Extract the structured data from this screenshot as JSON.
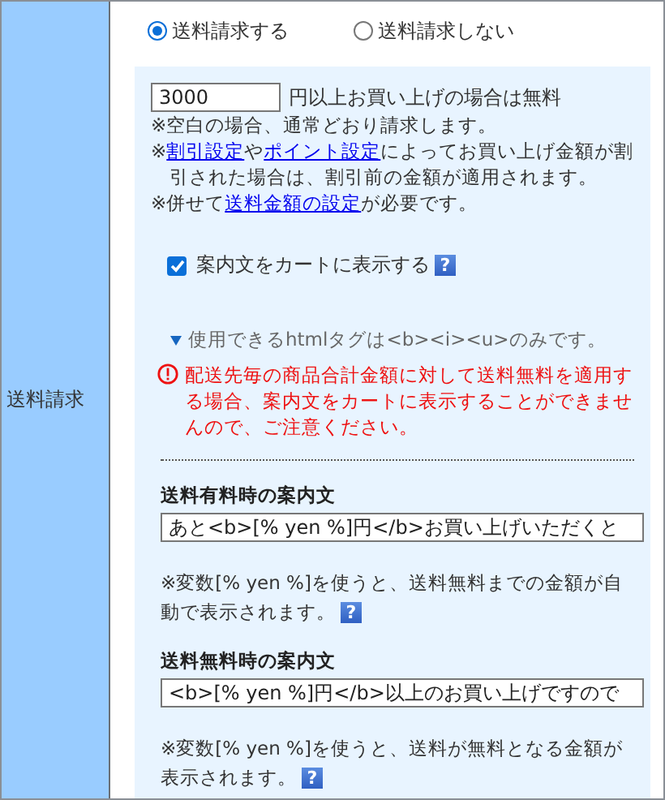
{
  "row_label": "送料請求",
  "radios": [
    {
      "label": "送料請求する",
      "selected": true
    },
    {
      "label": "送料請求しない",
      "selected": false
    }
  ],
  "threshold": {
    "value": "3000",
    "suffix": "円以上お買い上げの場合は無料"
  },
  "notes": [
    {
      "parts": [
        {
          "text": "※空白の場合、通常どおり請求します。",
          "link": false
        }
      ]
    },
    {
      "parts": [
        {
          "text": "※",
          "link": false
        },
        {
          "text": "割引設定",
          "link": true
        },
        {
          "text": "や",
          "link": false
        },
        {
          "text": "ポイント設定",
          "link": true
        },
        {
          "text": "によってお買い上げ金額が割引された場合は、割引前の金額が適用されます。",
          "link": false
        }
      ]
    },
    {
      "parts": [
        {
          "text": "※併せて",
          "link": false
        },
        {
          "text": "送料金額の設定",
          "link": true
        },
        {
          "text": "が必要です。",
          "link": false
        }
      ]
    }
  ],
  "cart_option": {
    "label": "案内文をカートに表示する",
    "checked": true,
    "help": "?"
  },
  "tags_note": "使用できるhtmlタグは<b><i><u>のみです。",
  "warning": "配送先毎の商品合計金額に対して送料無料を適用する場合、案内文をカートに表示することができませんので、ご注意ください。",
  "messages": [
    {
      "title": "送料有料時の案内文",
      "value": "あと<b>[% yen %]円</b>お買い上げいただくと",
      "note": "※変数[% yen %]を使うと、送料無料までの金額が自動で表示されます。",
      "help": "?"
    },
    {
      "title": "送料無料時の案内文",
      "value": "<b>[% yen %]円</b>以上のお買い上げですので",
      "note": "※変数[% yen %]を使うと、送料が無料となる金額が表示されます。",
      "help": "?"
    }
  ]
}
